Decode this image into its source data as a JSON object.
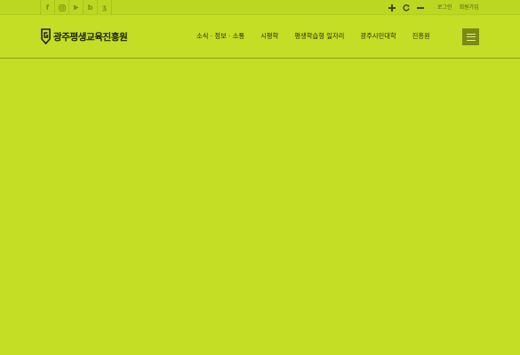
{
  "topbar": {
    "social": [
      {
        "icon": "facebook-icon",
        "glyph": "f"
      },
      {
        "icon": "instagram-icon",
        "glyph": ""
      },
      {
        "icon": "youtube-icon",
        "glyph": ""
      },
      {
        "icon": "blog-icon",
        "glyph": "b"
      },
      {
        "icon": "kakao-story-icon",
        "glyph": "ʒ"
      }
    ],
    "font_controls": [
      {
        "icon": "zoom-in-icon"
      },
      {
        "icon": "reset-icon"
      },
      {
        "icon": "zoom-out-icon"
      }
    ],
    "links": {
      "login": "로그인",
      "signup": "회원가입"
    }
  },
  "header": {
    "logo_text": "광주평생교육진흥원",
    "nav": [
      "소식 · 정보 · 소통",
      "시평학",
      "평생학습형 일자리",
      "광주시민대학",
      "진흥원"
    ],
    "menu_icon": "hamburger-menu-icon"
  },
  "colors": {
    "background": "#c3de25",
    "topbar": "#bcd722",
    "menu_button": "#7a8a13",
    "text_dark": "#1b1f08"
  }
}
